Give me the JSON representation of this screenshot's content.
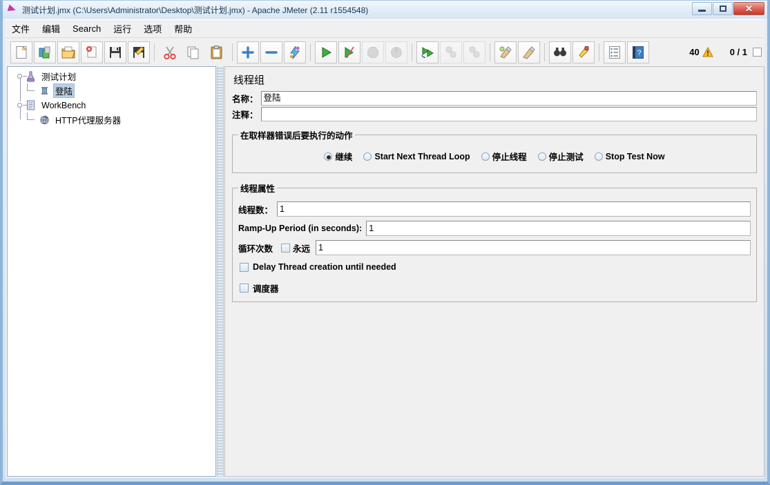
{
  "window": {
    "title": "测试计划.jmx (C:\\Users\\Administrator\\Desktop\\测试计划.jmx) - Apache JMeter (2.11 r1554548)",
    "minimize_label": "—",
    "maximize_label": "❐",
    "close_label": "✕"
  },
  "menu": {
    "items": [
      {
        "label": "文件"
      },
      {
        "label": "编辑"
      },
      {
        "label": "Search"
      },
      {
        "label": "运行"
      },
      {
        "label": "选项"
      },
      {
        "label": "帮助"
      }
    ]
  },
  "toolbar": {
    "buttons": [
      {
        "name": "new-icon",
        "title": "新建"
      },
      {
        "name": "templates-icon",
        "title": "模板"
      },
      {
        "name": "open-icon",
        "title": "打开"
      },
      {
        "name": "close-icon",
        "title": "关闭"
      },
      {
        "name": "save-icon",
        "title": "保存"
      },
      {
        "name": "save-as-icon",
        "title": "另存为"
      },
      {
        "name": "cut-icon",
        "title": "剪切"
      },
      {
        "name": "copy-icon",
        "title": "复制"
      },
      {
        "name": "paste-icon",
        "title": "粘贴"
      },
      {
        "name": "expand-all-icon",
        "title": "展开全部"
      },
      {
        "name": "collapse-all-icon",
        "title": "折叠全部"
      },
      {
        "name": "toggle-icon",
        "title": "切换"
      },
      {
        "name": "start-icon",
        "title": "启动"
      },
      {
        "name": "start-no-pauses-icon",
        "title": "无간隔启动"
      },
      {
        "name": "stop-icon",
        "title": "停止"
      },
      {
        "name": "shutdown-icon",
        "title": "关闭"
      },
      {
        "name": "remote-start-all-icon",
        "title": "远程全部启动"
      },
      {
        "name": "remote-stop-all-icon",
        "title": "远程全部停止"
      },
      {
        "name": "remote-shutdown-all-icon",
        "title": "远程全部关闭"
      },
      {
        "name": "clear-icon",
        "title": "清除"
      },
      {
        "name": "clear-all-icon",
        "title": "清除全部"
      },
      {
        "name": "search-icon",
        "title": "查找"
      },
      {
        "name": "search-reset-icon",
        "title": "重置查找"
      },
      {
        "name": "function-helper-icon",
        "title": "函数助手对话框"
      },
      {
        "name": "help-icon",
        "title": "帮助"
      }
    ],
    "status": {
      "warning_count": "40",
      "thread_counter": "0 / 1"
    }
  },
  "tree": {
    "nodes": [
      {
        "label": "测试计划",
        "icon": "test-plan-icon",
        "selected": false,
        "depth": 0
      },
      {
        "label": "登陆",
        "icon": "thread-group-icon",
        "selected": true,
        "depth": 1
      },
      {
        "label": "WorkBench",
        "icon": "workbench-icon",
        "selected": false,
        "depth": 0
      },
      {
        "label": "HTTP代理服务器",
        "icon": "http-proxy-icon",
        "selected": false,
        "depth": 1
      }
    ]
  },
  "detail": {
    "title": "线程组",
    "name_label": "名称：",
    "name_value": "登陆",
    "comment_label": "注释：",
    "comment_value": "",
    "error_action": {
      "legend": "在取样器错误后要执行的动作",
      "options": [
        {
          "label": "继续",
          "checked": true
        },
        {
          "label": "Start Next Thread Loop",
          "checked": false
        },
        {
          "label": "停止线程",
          "checked": false
        },
        {
          "label": "停止测试",
          "checked": false
        },
        {
          "label": "Stop Test Now",
          "checked": false
        }
      ]
    },
    "thread_properties": {
      "legend": "线程属性",
      "num_threads_label": "线程数：",
      "num_threads_value": "1",
      "ramp_up_label": "Ramp-Up Period (in seconds):",
      "ramp_up_value": "1",
      "loop_count_label": "循环次数",
      "forever_label": "永远",
      "forever_checked": false,
      "loop_count_value": "1",
      "delay_creation_label": "Delay Thread creation until needed",
      "delay_creation_checked": false,
      "scheduler_label": "调度器",
      "scheduler_checked": false
    }
  },
  "colors": {
    "selection": "#b9cfe4",
    "panel_bg": "#f0f0f0",
    "frame_blue": "#8fb4d9",
    "warning": "#f5b800",
    "close_red": "#c4392c"
  }
}
